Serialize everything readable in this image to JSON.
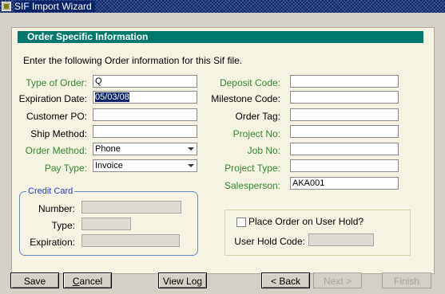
{
  "window": {
    "title": "SIF Import Wizard"
  },
  "panel": {
    "header": "Order Specific Information",
    "intro": "Enter the following Order information for this Sif file."
  },
  "left_fields": {
    "type_of_order": {
      "label": "Type of Order:",
      "value": "Q"
    },
    "expiration_date": {
      "label": "Expiration Date:",
      "value": "05/03/08"
    },
    "customer_po": {
      "label": "Customer PO:",
      "value": ""
    },
    "ship_method": {
      "label": "Ship Method:",
      "value": ""
    },
    "order_method": {
      "label": "Order Method:",
      "value": "Phone"
    },
    "pay_type": {
      "label": "Pay Type:",
      "value": "Invoice"
    }
  },
  "right_fields": {
    "deposit_code": {
      "label": "Deposit Code:",
      "value": ""
    },
    "milestone_code": {
      "label": "Milestone Code:",
      "value": ""
    },
    "order_tag": {
      "label": "Order Tag:",
      "value": ""
    },
    "project_no": {
      "label": "Project No:",
      "value": ""
    },
    "job_no": {
      "label": "Job No:",
      "value": ""
    },
    "project_type": {
      "label": "Project Type:",
      "value": ""
    },
    "salesperson": {
      "label": "Salesperson:",
      "value": "AKA001"
    }
  },
  "credit_card": {
    "title": "Credit Card",
    "number_label": "Number:",
    "type_label": "Type:",
    "expiration_label": "Expiration:"
  },
  "hold": {
    "checkbox_label": "Place Order on User Hold?",
    "checked": false,
    "code_label": "User Hold Code:"
  },
  "buttons": {
    "save": "Save",
    "cancel_rest": "ancel",
    "cancel_mnemonic": "C",
    "view_log": "View Log",
    "back": "< Back",
    "next": "Next >",
    "finish": "Finish"
  },
  "colors": {
    "header_bg": "#00786e",
    "title_bg": "#0a246a",
    "required_label": "#2e8b2e"
  }
}
